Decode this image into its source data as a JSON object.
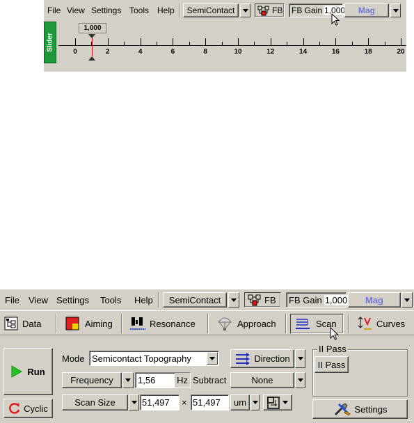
{
  "top": {
    "menu": [
      "File",
      "View",
      "Settings",
      "Tools",
      "Help"
    ],
    "mode_dropdown": "SemiContact",
    "fb_label": "FB",
    "fb_gain_label": "FB Gain",
    "fb_gain_value": "1,000",
    "mag_label": "Mag",
    "slider_tab": "Slider",
    "slider_value": "1,000",
    "slider_position": 1.0,
    "scale_ticks": [
      "0",
      "2",
      "4",
      "6",
      "8",
      "10",
      "12",
      "14",
      "16",
      "18",
      "20"
    ]
  },
  "bottom": {
    "menu": [
      "File",
      "View",
      "Settings",
      "Tools",
      "Help"
    ],
    "mode_dropdown": "SemiContact",
    "fb_label": "FB",
    "fb_gain_label": "FB Gain",
    "fb_gain_value": "1,000",
    "mag_label": "Mag",
    "tabs": [
      "Data",
      "Aiming",
      "Resonance",
      "Approach",
      "Scan",
      "Curves"
    ],
    "run_label": "Run",
    "cyclic_label": "Cyclic",
    "mode_label": "Mode",
    "mode_value": "Semicontact Topography",
    "direction_label": "Direction",
    "frequency_label": "Frequency",
    "frequency_value": "1,56",
    "frequency_unit": "Hz",
    "subtract_label": "Subtract",
    "subtract_value": "None",
    "scan_size_label": "Scan Size",
    "scan_size_x": "51,497",
    "times": "×",
    "scan_size_y": "51,497",
    "scan_unit": "um",
    "ii_pass_group": "II Pass",
    "ii_pass_button": "II Pass",
    "settings_label": "Settings"
  },
  "colors": {
    "face": "#d4d0c8",
    "mag": "#6b78d6",
    "slider_tab": "#1e9a3a",
    "run_arrow": "#22c022",
    "cyclic": "#e02020"
  }
}
